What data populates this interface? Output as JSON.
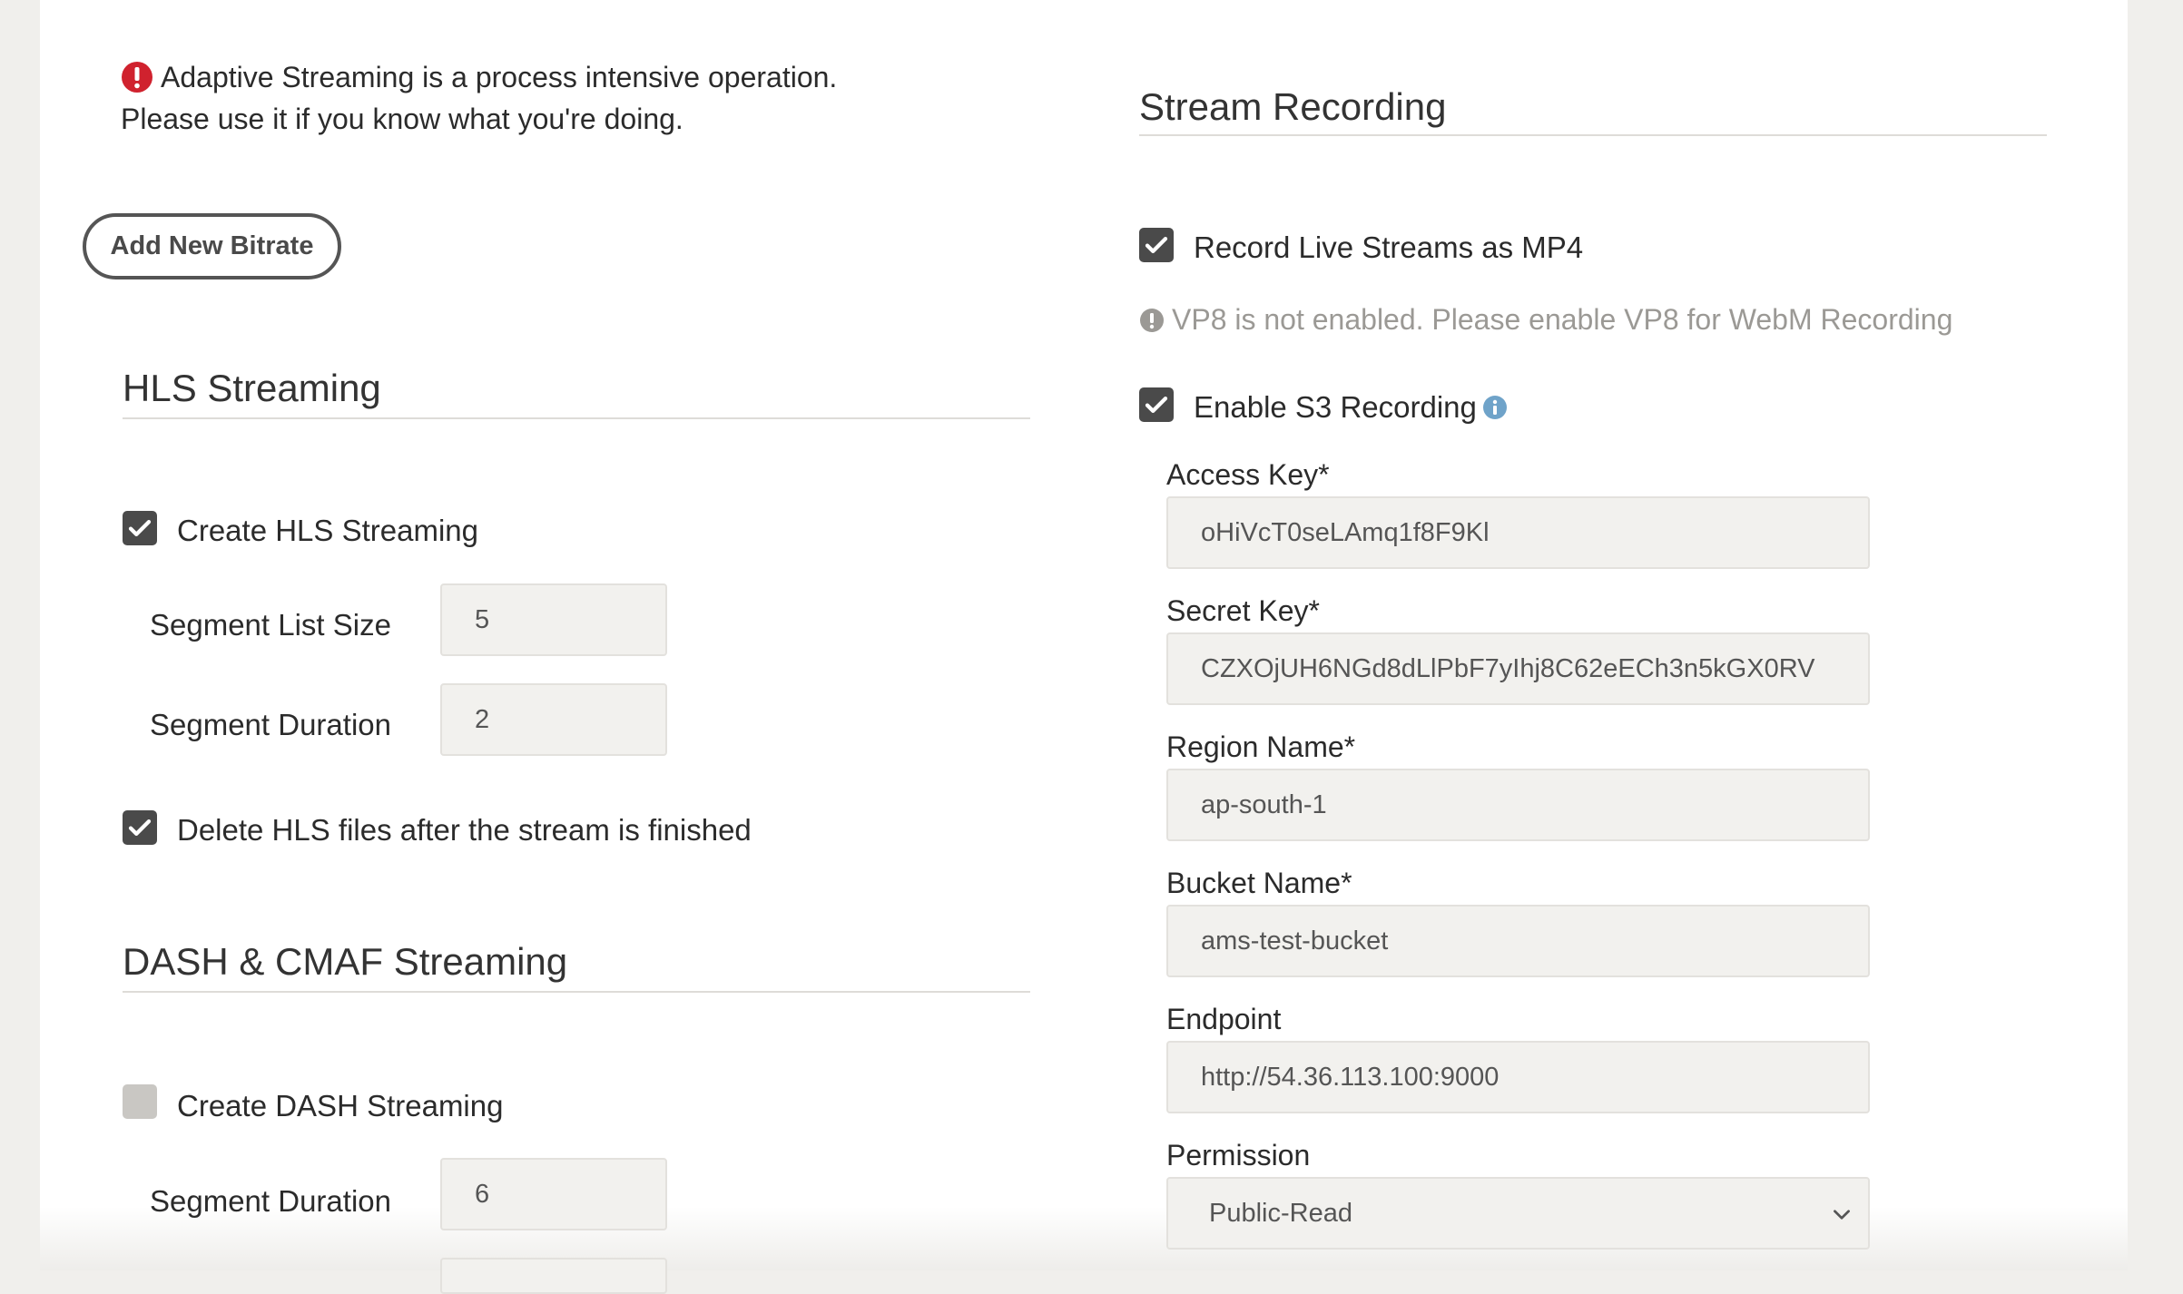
{
  "left": {
    "warning": {
      "line1": "Adaptive Streaming is a process intensive operation.",
      "line2": "Please use it if you know what you're doing."
    },
    "add_bitrate_label": "Add New Bitrate",
    "hls": {
      "title": "HLS Streaming",
      "create_label": "Create HLS Streaming",
      "create_checked": true,
      "segment_list_size_label": "Segment List Size",
      "segment_list_size_value": "5",
      "segment_duration_label": "Segment Duration",
      "segment_duration_value": "2",
      "delete_label": "Delete HLS files after the stream is finished",
      "delete_checked": true
    },
    "dash": {
      "title": "DASH & CMAF Streaming",
      "create_label": "Create DASH Streaming",
      "create_checked": false,
      "segment_duration_label": "Segment Duration",
      "segment_duration_value": "6"
    }
  },
  "right": {
    "title": "Stream Recording",
    "record_mp4_label": "Record Live Streams as MP4",
    "record_mp4_checked": true,
    "vp8_notice": "VP8 is not enabled. Please enable VP8 for WebM Recording",
    "s3_label": "Enable S3 Recording",
    "s3_checked": true,
    "access_key_label": "Access Key*",
    "access_key_value": "oHiVcT0seLAmq1f8F9Kl",
    "secret_key_label": "Secret Key*",
    "secret_key_value": "CZXOjUH6NGd8dLlPbF7yIhj8C62eECh3n5kGX0RV",
    "region_label": "Region Name*",
    "region_value": "ap-south-1",
    "bucket_label": "Bucket Name*",
    "bucket_value": "ams-test-bucket",
    "endpoint_label": "Endpoint",
    "endpoint_value": "http://54.36.113.100:9000",
    "permission_label": "Permission",
    "permission_value": "Public-Read"
  },
  "colors": {
    "alert_red": "#d0222e",
    "checkbox_on": "#4a4a4a",
    "checkbox_off": "#c9c7c3",
    "info_blue": "#6fa3c9",
    "muted_text": "#9b9995"
  },
  "icons": {
    "alert": "exclamation-circle-icon",
    "check": "checkmark-icon",
    "notice": "exclamation-circle-icon",
    "info": "info-circle-icon",
    "chevron": "chevron-down-icon"
  }
}
